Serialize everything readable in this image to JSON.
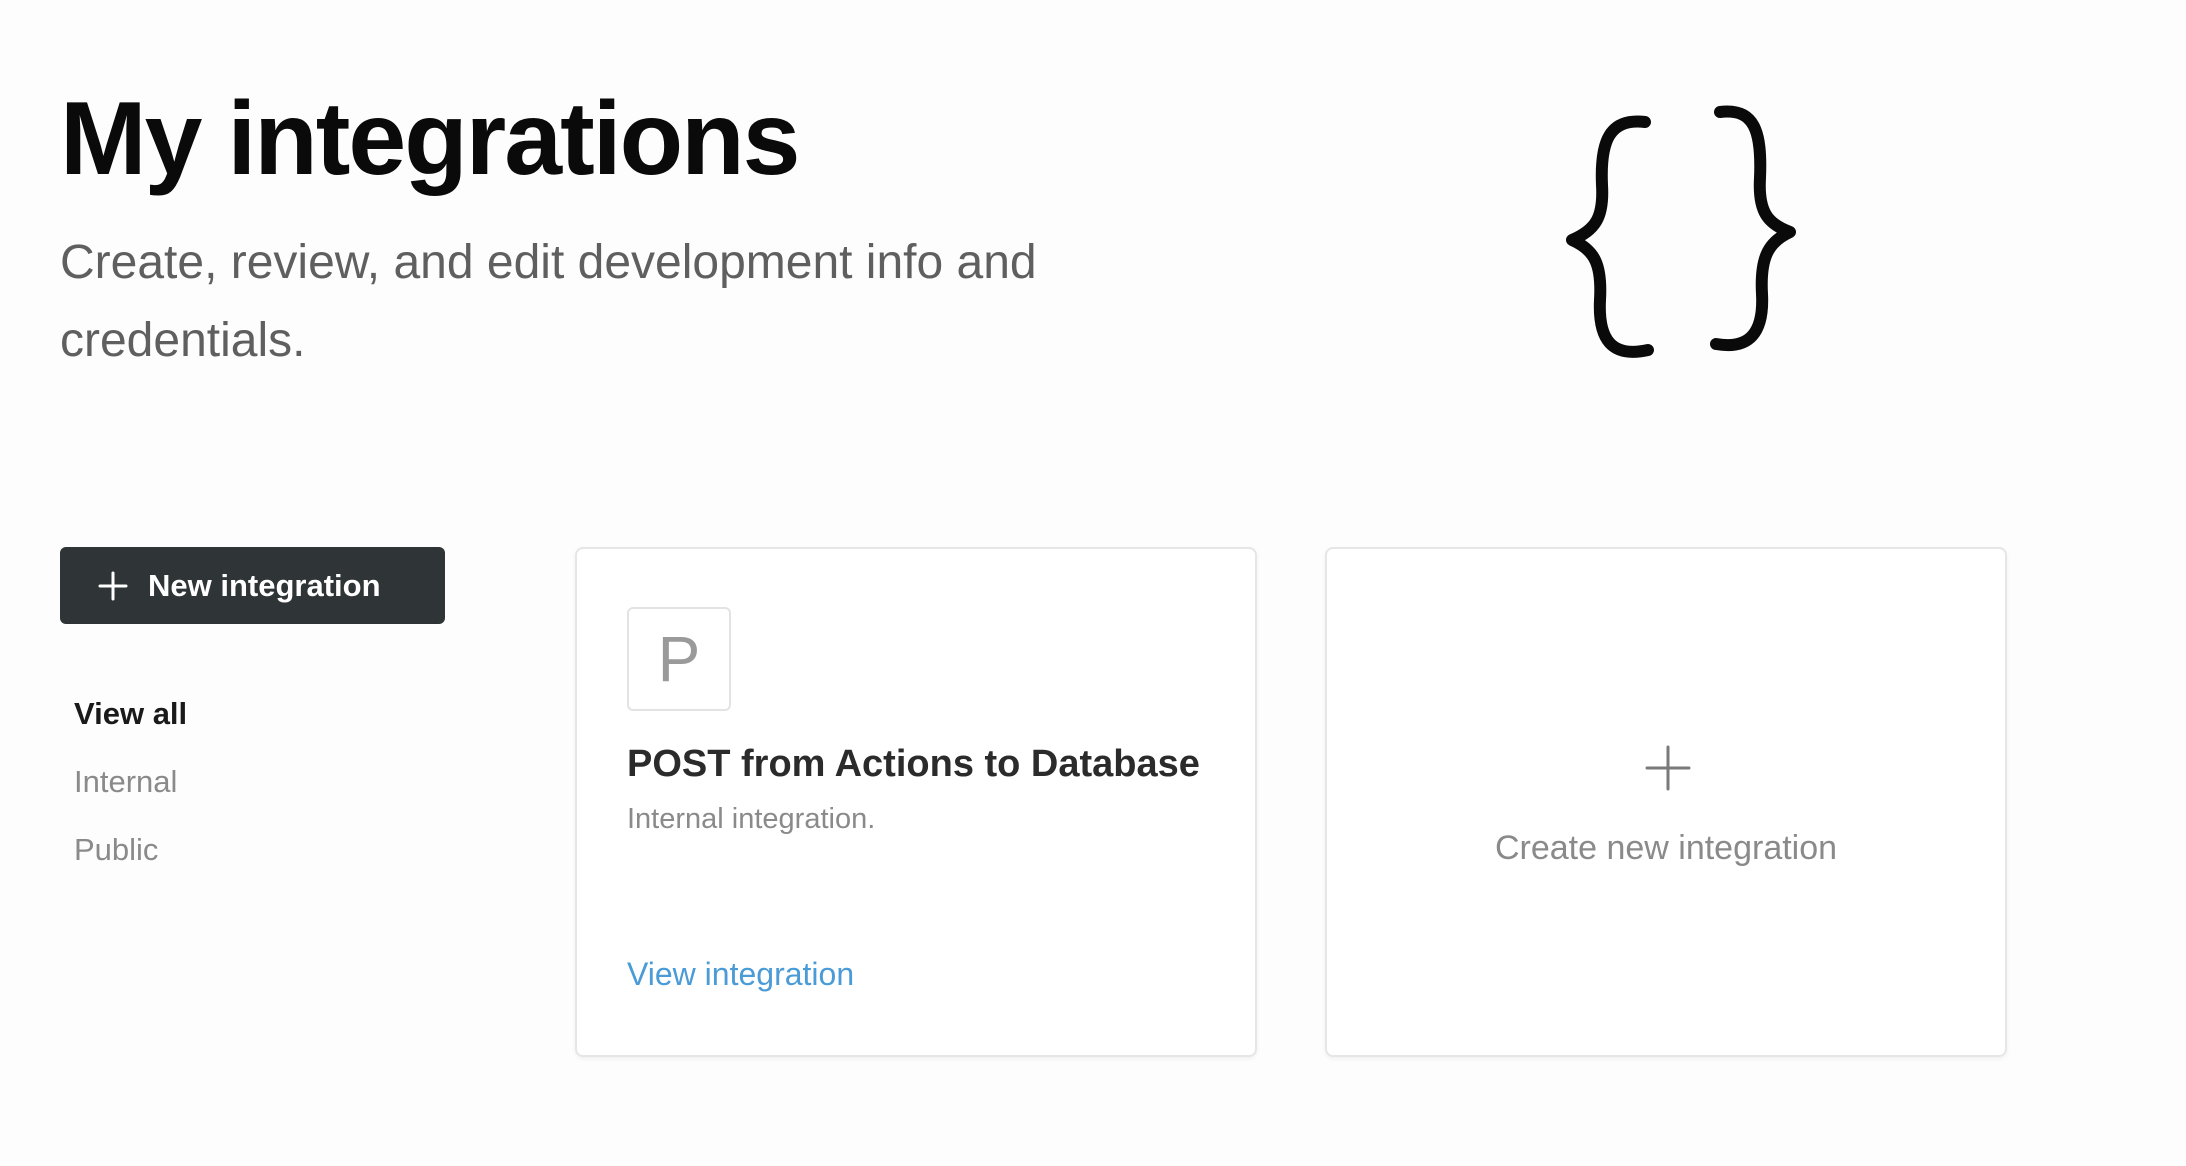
{
  "header": {
    "title": "My integrations",
    "subtitle": "Create, review, and edit development info and credentials.",
    "illustration_icon": "curly-braces-icon"
  },
  "sidebar": {
    "new_button_label": "New integration",
    "new_button_icon": "plus-icon",
    "button_color": "#2f3437",
    "filters": [
      {
        "label": "View all",
        "active": true
      },
      {
        "label": "Internal",
        "active": false
      },
      {
        "label": "Public",
        "active": false
      }
    ]
  },
  "integrations": [
    {
      "avatar_letter": "P",
      "name": "POST from Actions to Database",
      "type": "Internal integration.",
      "link_label": "View integration",
      "link_color": "#4a9bd6"
    }
  ],
  "create_card": {
    "icon": "plus-icon",
    "label": "Create new integration"
  }
}
